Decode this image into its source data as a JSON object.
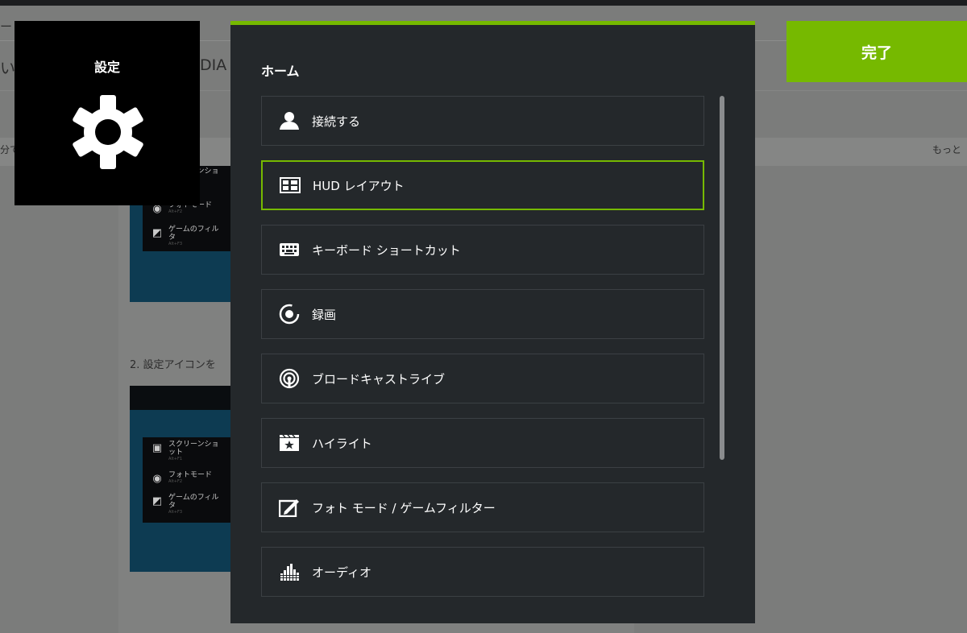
{
  "background_page": {
    "row1_fragment": "ー ン",
    "row2_fragment_left": "い",
    "row2_fragment_right": "DIA G",
    "row3_left": "分で",
    "row3_right": "もっと",
    "step2_text": "2. 設定アイコンを",
    "thumb_menu": [
      {
        "icon": "image-icon",
        "label": "スクリーンショット",
        "sub": "Alt+F1"
      },
      {
        "icon": "camera-icon",
        "label": "フォトモード",
        "sub": "Alt+F2"
      },
      {
        "icon": "filter-icon",
        "label": "ゲームのフィルタ",
        "sub": "Alt+F3"
      }
    ]
  },
  "settings_tile": {
    "title": "設定",
    "icon": "gear-icon"
  },
  "done_button": {
    "label": "完了"
  },
  "panel": {
    "title": "ホーム",
    "items": [
      {
        "label": "接続する",
        "icon": "user-icon"
      },
      {
        "label": "HUD レイアウト",
        "icon": "layout-icon",
        "selected": true
      },
      {
        "label": "キーボード ショートカット",
        "icon": "keyboard-icon"
      },
      {
        "label": "録画",
        "icon": "record-icon"
      },
      {
        "label": "ブロードキャストライブ",
        "icon": "broadcast-icon"
      },
      {
        "label": "ハイライト",
        "icon": "highlight-icon"
      },
      {
        "label": "フォト モード / ゲームフィルター",
        "icon": "photo-filter-icon"
      },
      {
        "label": "オーディオ",
        "icon": "audio-icon"
      }
    ]
  },
  "colors": {
    "accent": "#76b900",
    "panel_bg": "#24282b",
    "overlay_bg": "#7b7c7b"
  }
}
